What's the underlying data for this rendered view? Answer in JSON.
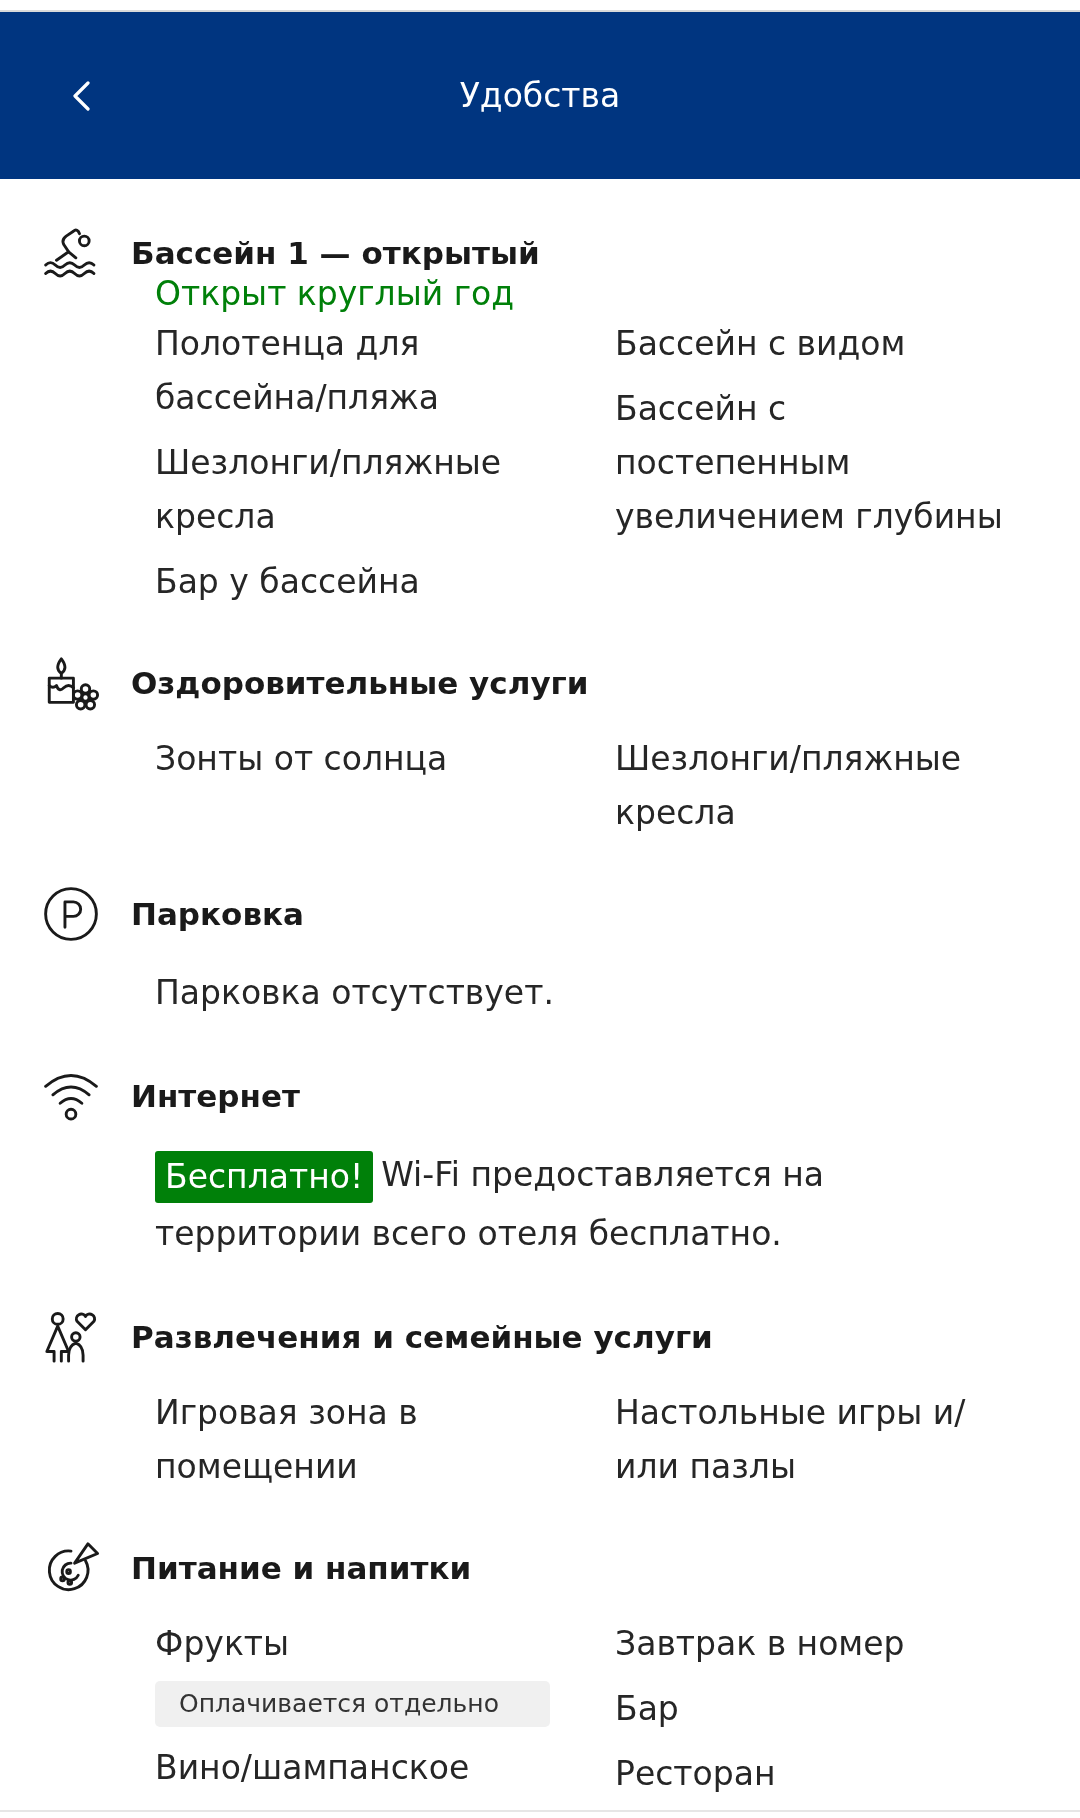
{
  "header": {
    "title": "Удобства"
  },
  "sections": [
    {
      "title": "Бассейн 1 — открытый",
      "status": "Открыт круглый год",
      "columns": [
        [
          {
            "text": "Полотенца для бассейна/пляжа"
          },
          {
            "text": "Шезлонги/пляжные кресла"
          },
          {
            "text": "Бар у бассейна"
          }
        ],
        [
          {
            "text": "Бассейн с видом"
          },
          {
            "text": "Бассейн с постепенным увеличением глубины"
          }
        ]
      ]
    },
    {
      "title": "Оздоровительные услуги",
      "columns": [
        [
          {
            "text": "Зонты от солнца"
          }
        ],
        [
          {
            "text": "Шезлонги/пляжные кресла"
          }
        ]
      ]
    },
    {
      "title": "Парковка",
      "paragraph": {
        "text": "Парковка отсутствует."
      }
    },
    {
      "title": "Интернет",
      "paragraph": {
        "badge": "Бесплатно!",
        "text": "Wi-Fi предоставляется на территории всего отеля бесплатно."
      }
    },
    {
      "title": "Развлечения и семейные услуги",
      "columns": [
        [
          {
            "text": "Игровая зона в помещении"
          }
        ],
        [
          {
            "text": "Настольные игры и/или пазлы"
          }
        ]
      ]
    },
    {
      "title": "Питание и напитки",
      "columns": [
        [
          {
            "text": "Фрукты",
            "note": "Оплачивается отдельно"
          },
          {
            "text": "Вино/шампанское"
          }
        ],
        [
          {
            "text": "Завтрак в номер"
          },
          {
            "text": "Бар"
          },
          {
            "text": "Ресторан"
          }
        ]
      ]
    }
  ]
}
